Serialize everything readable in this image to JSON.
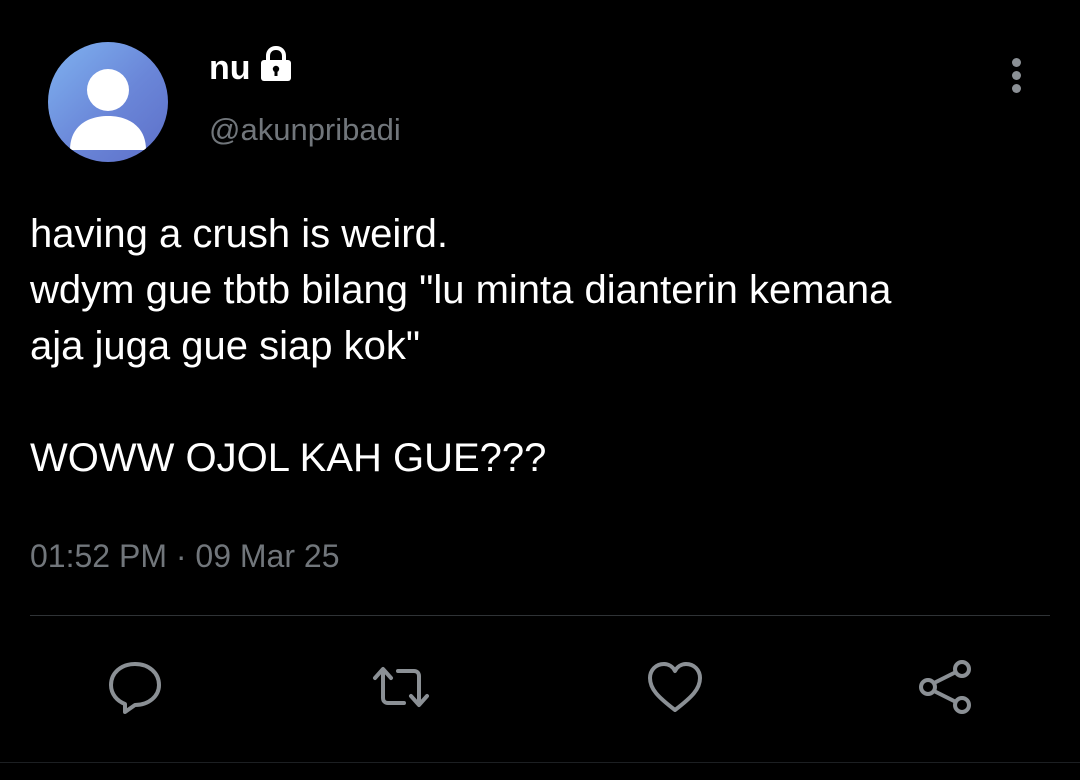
{
  "tweet": {
    "author": {
      "display_name": "nu",
      "username": "@akunpribadi",
      "protected_icon": "lock-icon",
      "avatar_icon": "default-user-avatar"
    },
    "text_lines": [
      "having a crush is weird.",
      "wdym gue tbtb bilang \"lu minta dianterin kemana",
      "aja juga gue siap kok\"",
      "",
      "WOWW OJOL KAH GUE???"
    ],
    "timestamp": "01:52 PM · 09 Mar 25",
    "actions": {
      "reply_icon": "speech-bubble-icon",
      "retweet_icon": "retweet-icon",
      "like_icon": "heart-icon",
      "share_icon": "share-icon"
    }
  },
  "colors": {
    "background": "#000000",
    "text_primary": "#ffffff",
    "text_secondary": "#71767b",
    "icon": "#8b9095",
    "divider": "#2f3336",
    "avatar_gradient": [
      "#7fb2f0",
      "#5d6fc8"
    ]
  }
}
